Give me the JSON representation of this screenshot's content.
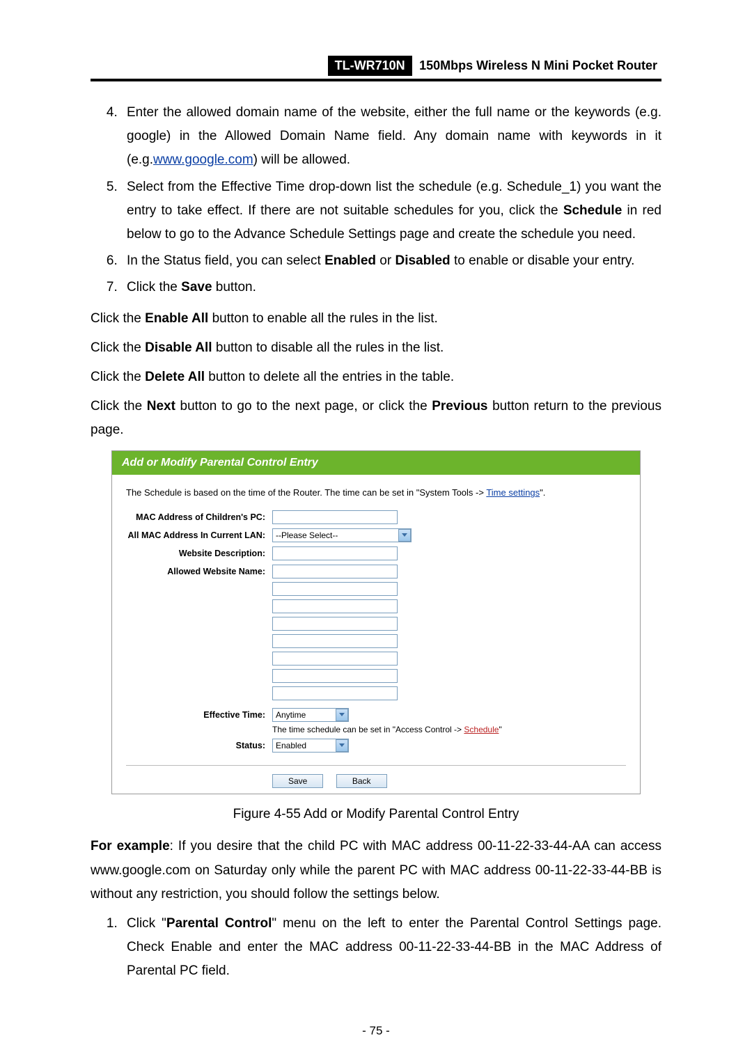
{
  "header": {
    "model": "TL-WR710N",
    "title": "150Mbps Wireless N Mini Pocket Router"
  },
  "steps_a": {
    "4": {
      "pre": "Enter the allowed domain name of the website, either the full name or the keywords (e.g. google) in the Allowed Domain Name field. Any domain name with keywords in it (e.g.",
      "link": "www.google.com",
      "post": ") will be allowed."
    },
    "5": {
      "pre": "Select from the Effective Time drop-down list the schedule (e.g. Schedule_1) you want the entry to take effect. If there are not suitable schedules for you, click the ",
      "bold": "Schedule",
      "post": " in red below to go to the Advance Schedule Settings page and create the schedule you need."
    },
    "6": {
      "pre": "In the Status field, you can select ",
      "b1": "Enabled",
      "or": " or ",
      "b2": "Disabled",
      "post": " to enable or disable your entry."
    },
    "7": {
      "pre": "Click the ",
      "b": "Save",
      "post": " button."
    }
  },
  "paras": {
    "enable": {
      "pre": "Click the ",
      "b": "Enable All",
      "post": " button to enable all the rules in the list."
    },
    "disable": {
      "pre": "Click the ",
      "b": "Disable All",
      "post": " button to disable all the rules in the list."
    },
    "delete": {
      "pre": "Click the ",
      "b": "Delete All",
      "post": " button to delete all the entries in the table."
    },
    "nextprev": {
      "pre": "Click the ",
      "b1": "Next",
      "mid": " button to go to the next page, or click the ",
      "b2": "Previous",
      "post": " button return to the previous page."
    }
  },
  "figure": {
    "title": "Add or Modify Parental Control Entry",
    "note_pre": "The Schedule is based on the time of the Router. The time can be set in \"System Tools -> ",
    "note_link": "Time settings",
    "note_post": "\".",
    "labels": {
      "mac": "MAC Address of Children's PC:",
      "lan": "All MAC Address In Current LAN:",
      "desc": "Website Description:",
      "allowed": "Allowed Website Name:",
      "eff": "Effective Time:",
      "status": "Status:"
    },
    "lan_select": "--Please Select--",
    "eff_select": "Anytime",
    "eff_note_pre": "The time schedule can be set in \"Access Control -> ",
    "eff_note_link": "Schedule",
    "eff_note_post": "\"",
    "status_select": "Enabled",
    "buttons": {
      "save": "Save",
      "back": "Back"
    }
  },
  "figcap": "Figure 4-55    Add or Modify Parental Control Entry",
  "example": {
    "lead": "For example",
    "text": ": If you desire that the child PC with MAC address 00-11-22-33-44-AA can access www.google.com on Saturday only while the parent PC with MAC address 00-11-22-33-44-BB is without any restriction, you should follow the settings below."
  },
  "steps_b": {
    "1": {
      "pre": "Click \"",
      "b": "Parental Control",
      "post": "\" menu on the left to enter the Parental Control Settings page. Check Enable and enter the MAC address 00-11-22-33-44-BB in the MAC Address of Parental PC field."
    }
  },
  "pagenum": "- 75 -"
}
